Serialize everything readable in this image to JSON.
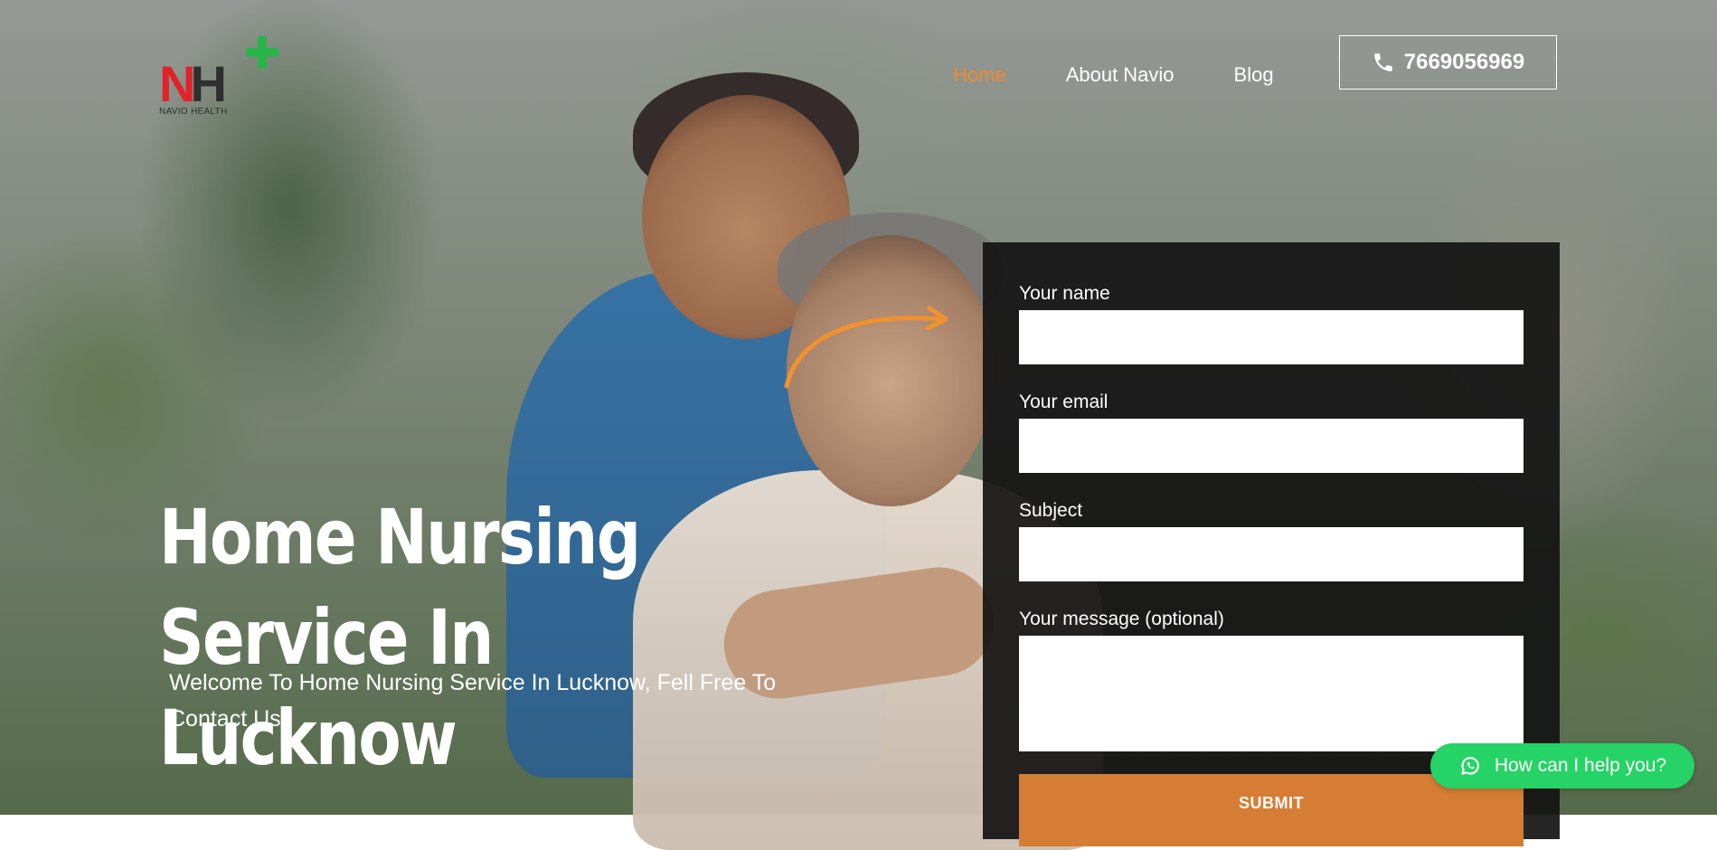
{
  "logo": {
    "letters_left": "N",
    "letters_right": "H",
    "subtitle": "NAVIO HEALTH",
    "colors": {
      "n": "#e0232b",
      "h": "#2f2f2f",
      "plus": "#29b34a"
    }
  },
  "nav": {
    "items": [
      {
        "label": "Home",
        "active": true
      },
      {
        "label": "About Navio",
        "active": false
      },
      {
        "label": "Blog",
        "active": false
      }
    ],
    "active_color": "#f08a2e"
  },
  "phone": {
    "icon": "phone-icon",
    "number": "7669056969"
  },
  "hero": {
    "title": "Home Nursing Service In Lucknow",
    "subtitle": "Welcome To Home Nursing Service In Lucknow, Fell Free To Contact Us"
  },
  "form": {
    "fields": [
      {
        "label": "Your name",
        "value": ""
      },
      {
        "label": "Your email",
        "value": ""
      },
      {
        "label": "Subject",
        "value": ""
      },
      {
        "label": "Your message (optional)",
        "value": ""
      }
    ],
    "submit_label": "SUBMIT",
    "submit_color": "#d57d34"
  },
  "whatsapp": {
    "icon": "whatsapp-icon",
    "label": "How can I help you?",
    "color": "#25d366"
  }
}
